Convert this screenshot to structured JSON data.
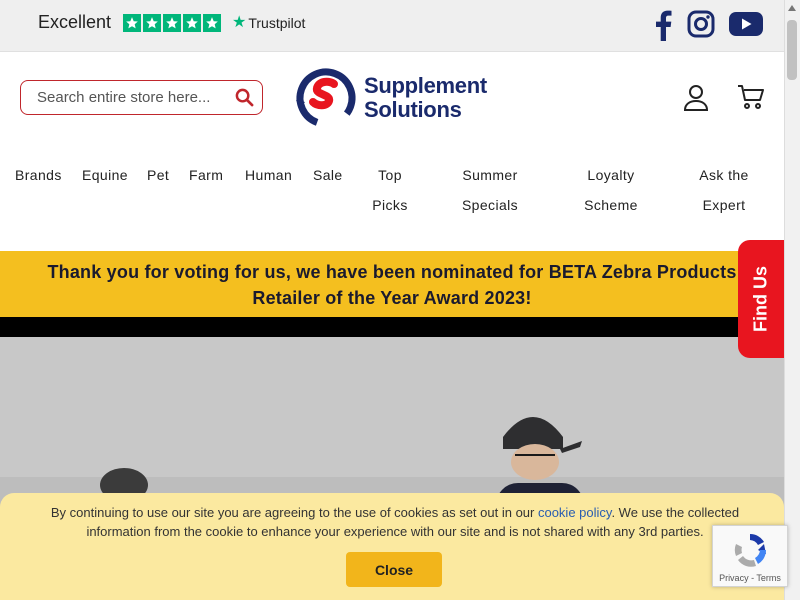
{
  "topbar": {
    "rating_label": "Excellent",
    "trustpilot_label": "Trustpilot",
    "social": [
      "facebook-icon",
      "instagram-icon",
      "youtube-icon"
    ]
  },
  "header": {
    "search_placeholder": "Search entire store here...",
    "logo_line1": "Supplement",
    "logo_line2": "Solutions"
  },
  "nav": {
    "items": [
      {
        "label": "Brands"
      },
      {
        "label": "Equine"
      },
      {
        "label": "Pet"
      },
      {
        "label": "Farm"
      },
      {
        "label": "Human"
      },
      {
        "label": "Sale"
      },
      {
        "label1": "Top",
        "label2": "Picks"
      },
      {
        "label1": "Summer",
        "label2": "Specials"
      },
      {
        "label1": "Loyalty",
        "label2": "Scheme"
      },
      {
        "label1": "Ask the",
        "label2": "Expert"
      }
    ]
  },
  "banner": {
    "line1": "Thank you for voting for us, we have been nominated for BETA Zebra Products",
    "line2": "Retailer of the Year Award 2023!"
  },
  "findus": {
    "label": "Find Us"
  },
  "cookie": {
    "text_before": "By continuing to use our site you are agreeing to the use of cookies as set out in our ",
    "link": "cookie policy",
    "text_after": ". We use the collected information from the cookie to enhance your experience with our site and is not shared with any 3rd parties.",
    "close_label": "Close"
  },
  "recaptcha": {
    "privacy": "Privacy",
    "sep": " - ",
    "terms": "Terms"
  },
  "colors": {
    "brand_red": "#e8151f",
    "brand_navy": "#1a2a6c",
    "banner_yellow": "#f4bf1f",
    "trustpilot_green": "#00b67a"
  }
}
